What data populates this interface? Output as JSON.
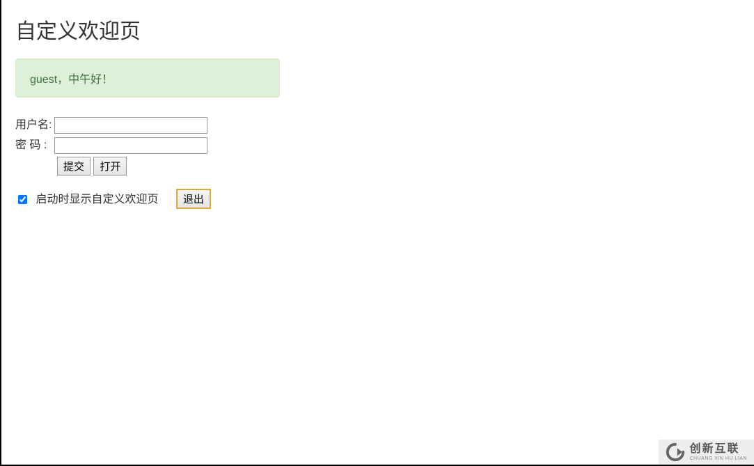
{
  "page": {
    "title": "自定义欢迎页"
  },
  "alert": {
    "message": "guest，中午好！"
  },
  "form": {
    "username_label": "用户名:",
    "password_label": "密  码 :",
    "username_value": "",
    "password_value": "",
    "submit_label": "提交",
    "open_label": "打开"
  },
  "options": {
    "checkbox_label": "启动时显示自定义欢迎页",
    "checkbox_checked": true,
    "exit_label": "退出"
  },
  "watermark": {
    "brand_cn": "创新互联",
    "brand_en": "CHUANG XIN HU LIAN"
  }
}
